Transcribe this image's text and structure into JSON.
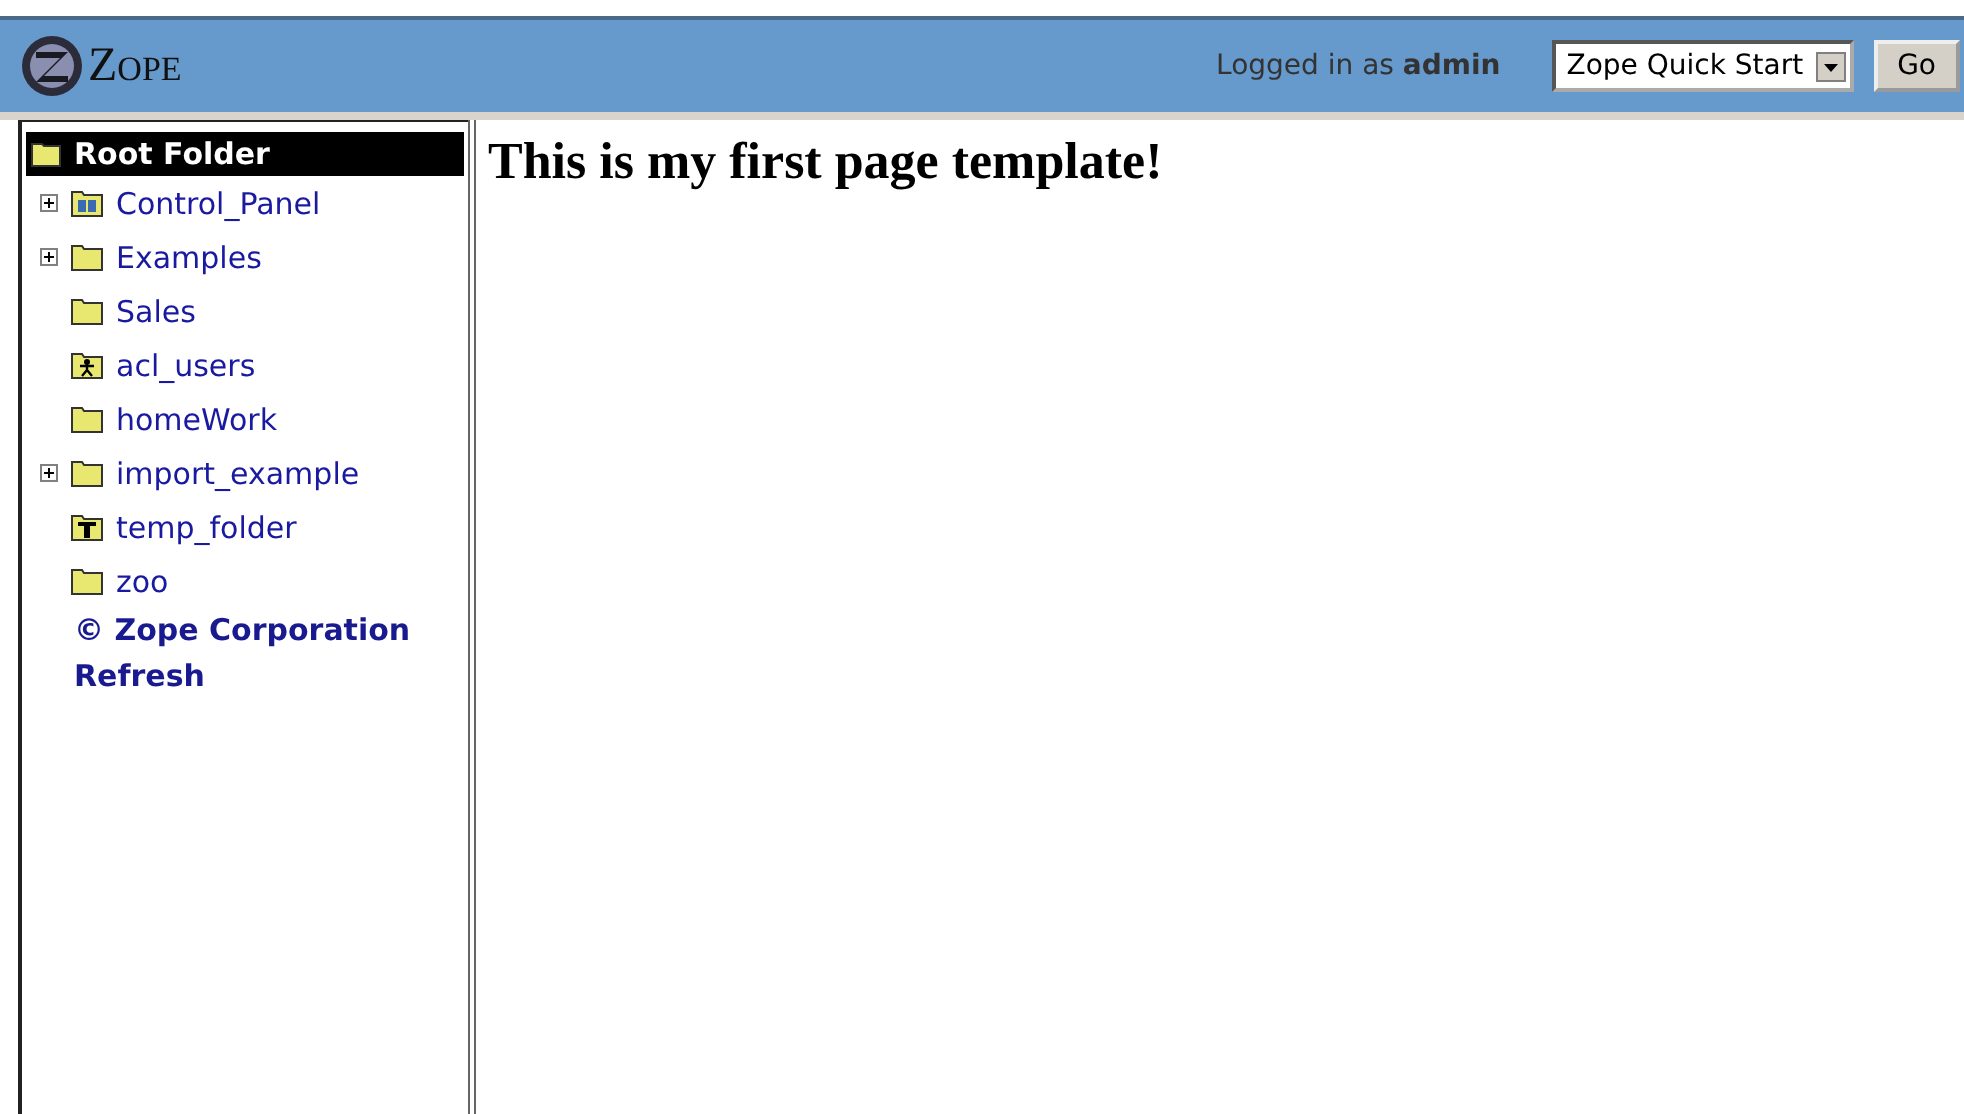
{
  "header": {
    "logo": "ZOPE",
    "login_label": "Logged in as",
    "login_user": "admin",
    "quick_start": {
      "value": "Zope Quick Start"
    },
    "go_button": "Go"
  },
  "tree": {
    "root": "Root Folder",
    "items": [
      {
        "label": "Control_Panel",
        "kind": "control",
        "expandable": true
      },
      {
        "label": "Examples",
        "kind": "folder",
        "expandable": true
      },
      {
        "label": "Sales",
        "kind": "folder",
        "expandable": false
      },
      {
        "label": "acl_users",
        "kind": "users",
        "expandable": false
      },
      {
        "label": "homeWork",
        "kind": "folder",
        "expandable": false
      },
      {
        "label": "import_example",
        "kind": "folder",
        "expandable": true
      },
      {
        "label": "temp_folder",
        "kind": "temp",
        "expandable": false
      },
      {
        "label": "zoo",
        "kind": "folder",
        "expandable": false
      }
    ],
    "links": [
      "© Zope Corporation",
      "Refresh"
    ]
  },
  "content": {
    "heading": "This is my first page template!"
  }
}
